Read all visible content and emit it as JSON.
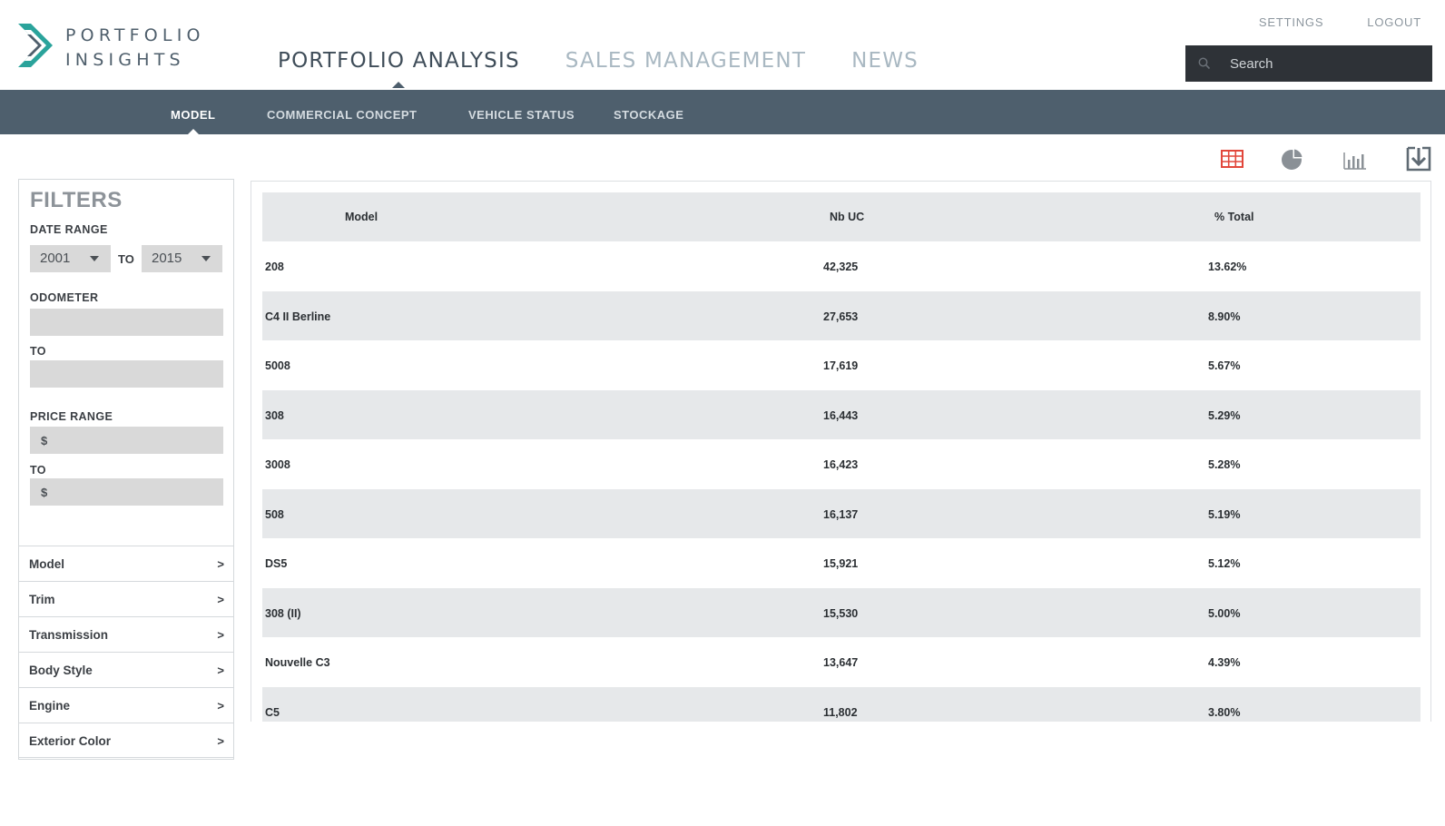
{
  "brand": {
    "logo_line1": "PORTFOLIO",
    "logo_line2": "INSIGHTS",
    "accent_color": "#2aa39b"
  },
  "top_links": [
    {
      "label": "SETTINGS"
    },
    {
      "label": "LOGOUT"
    }
  ],
  "search": {
    "placeholder": "Search",
    "value": ""
  },
  "main_nav": [
    {
      "label": "PORTFOLIO ANALYSIS",
      "active": true
    },
    {
      "label": "SALES MANAGEMENT",
      "active": false
    },
    {
      "label": "NEWS",
      "active": false
    }
  ],
  "sub_nav": [
    {
      "label": "MODEL",
      "active": true
    },
    {
      "label": "COMMERCIAL CONCEPT",
      "active": false
    },
    {
      "label": "VEHICLE STATUS",
      "active": false
    },
    {
      "label": "STOCKAGE",
      "active": false
    }
  ],
  "view_icons": [
    {
      "name": "table-view-icon",
      "active": true,
      "color": "#e2473b"
    },
    {
      "name": "pie-chart-view-icon",
      "active": false,
      "color": "#8a9096"
    },
    {
      "name": "bar-chart-view-icon",
      "active": false,
      "color": "#8a9096"
    },
    {
      "name": "download-icon",
      "active": false,
      "color": "#5f6a73"
    }
  ],
  "filters": {
    "title": "FILTERS",
    "date_range": {
      "label": "DATE RANGE",
      "from": "2001",
      "to_label": "TO",
      "to": "2015"
    },
    "odometer": {
      "label": "ODOMETER",
      "to_label": "TO",
      "from_value": "",
      "to_value": ""
    },
    "price_range": {
      "label": "PRICE RANGE",
      "to_label": "TO",
      "from_placeholder": "$",
      "to_placeholder": "$"
    },
    "facets": [
      {
        "label": "Model",
        "arrow": ">"
      },
      {
        "label": "Trim",
        "arrow": ">"
      },
      {
        "label": "Transmission",
        "arrow": ">"
      },
      {
        "label": "Body Style",
        "arrow": ">"
      },
      {
        "label": "Engine",
        "arrow": ">"
      },
      {
        "label": "Exterior Color",
        "arrow": ">"
      }
    ]
  },
  "table": {
    "columns": [
      "Model",
      "Nb UC",
      "% Total"
    ],
    "rows": [
      {
        "model": "208",
        "nb_uc": "42,325",
        "pct_total": "13.62%"
      },
      {
        "model": "C4 II Berline",
        "nb_uc": "27,653",
        "pct_total": "8.90%"
      },
      {
        "model": "5008",
        "nb_uc": "17,619",
        "pct_total": "5.67%"
      },
      {
        "model": "308",
        "nb_uc": "16,443",
        "pct_total": "5.29%"
      },
      {
        "model": "3008",
        "nb_uc": "16,423",
        "pct_total": "5.28%"
      },
      {
        "model": "508",
        "nb_uc": "16,137",
        "pct_total": "5.19%"
      },
      {
        "model": "DS5",
        "nb_uc": "15,921",
        "pct_total": "5.12%"
      },
      {
        "model": "308 (II)",
        "nb_uc": "15,530",
        "pct_total": "5.00%"
      },
      {
        "model": "Nouvelle C3",
        "nb_uc": "13,647",
        "pct_total": "4.39%"
      },
      {
        "model": "C5",
        "nb_uc": "11,802",
        "pct_total": "3.80%"
      }
    ]
  }
}
